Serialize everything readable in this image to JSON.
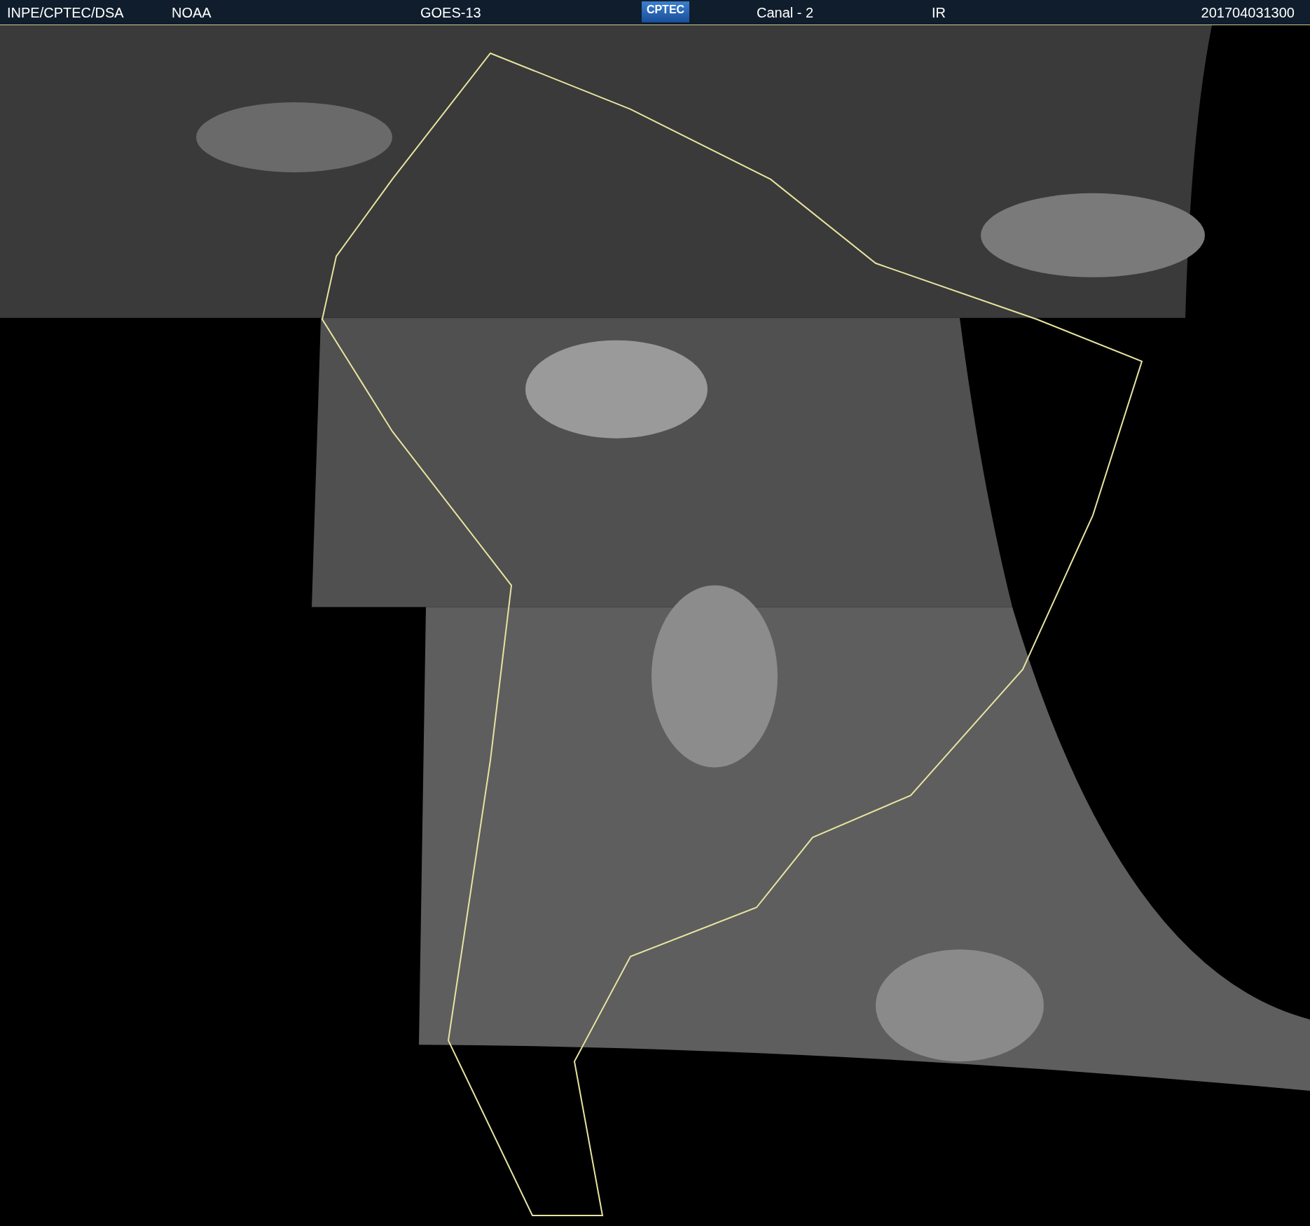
{
  "header": {
    "source": "INPE/CPTEC/DSA",
    "agency": "NOAA",
    "satellite": "GOES-13",
    "logo": "CPTEC",
    "channel": "Canal - 2",
    "band": "IR",
    "timestamp": "201704031300"
  }
}
